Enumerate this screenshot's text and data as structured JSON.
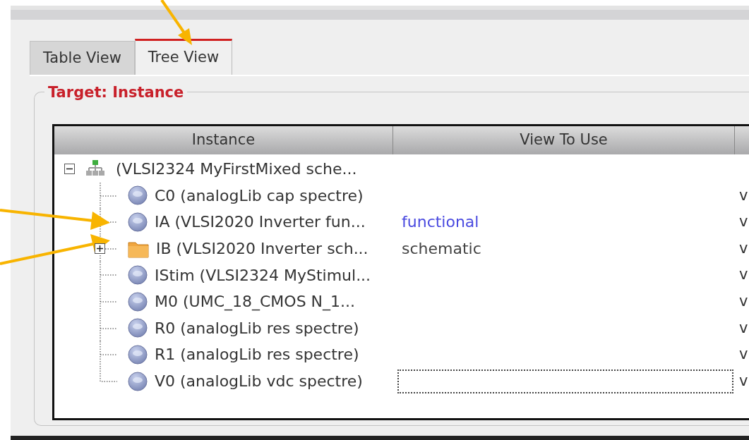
{
  "tabs": [
    {
      "label": "Table View",
      "selected": false
    },
    {
      "label": "Tree View",
      "selected": true
    }
  ],
  "group": {
    "title": "Target: Instance"
  },
  "table": {
    "columns": [
      "Instance",
      "View To Use"
    ],
    "tree": [
      {
        "label": "(VLSI2324 MyFirstMixed sche...",
        "kind": "design",
        "expanded": true,
        "children": [
          {
            "label": "C0 (analogLib cap spectre)",
            "kind": "object",
            "column_3": "v",
            "focused": false
          },
          {
            "label": "IA (VLSI2020 Inverter fun...",
            "kind": "object",
            "view": {
              "text": "functional",
              "color": "#4a4ae0"
            },
            "column_3": "v",
            "focused": false
          },
          {
            "label": "IB (VLSI2020 Inverter sch...",
            "kind": "folder",
            "expanded": false,
            "view": {
              "text": "schematic",
              "color": "#444444"
            },
            "column_3": "v",
            "focused": false
          },
          {
            "label": "IStim (VLSI2324 MyStimul...",
            "kind": "object",
            "column_3": "v",
            "focused": false
          },
          {
            "label": "M0 (UMC_18_CMOS N_1...",
            "kind": "object",
            "column_3": "v",
            "focused": false
          },
          {
            "label": "R0 (analogLib res spectre)",
            "kind": "object",
            "column_3": "v",
            "focused": false
          },
          {
            "label": "R1 (analogLib res spectre)",
            "kind": "object",
            "column_3": "v",
            "focused": false
          },
          {
            "label": "V0 (analogLib vdc spectre)",
            "kind": "object",
            "column_3": "v",
            "focused": true
          }
        ]
      }
    ]
  }
}
